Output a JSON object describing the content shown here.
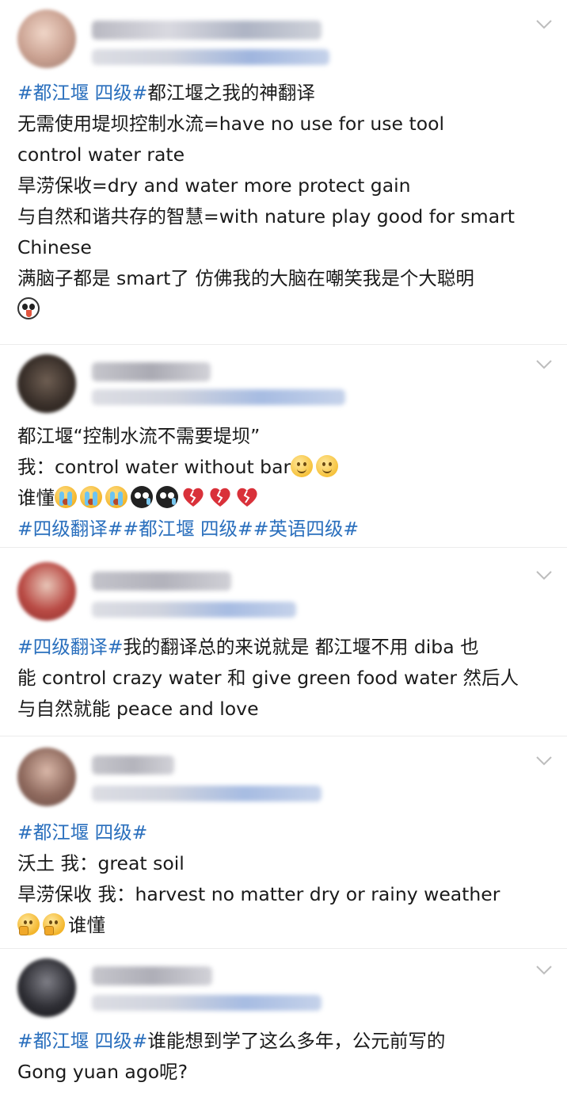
{
  "colors": {
    "hashtag": "#2a6fbd",
    "text": "#1a1a1a",
    "background": "#ffffff"
  },
  "posts": [
    {
      "lines": [
        [
          {
            "t": "tag",
            "v": "#都江堰 四级#"
          },
          {
            "t": "text",
            "v": "都江堰之我的神翻译"
          }
        ],
        [
          {
            "t": "text",
            "v": "无需使用堤坝控制水流=have no use for use tool"
          }
        ],
        [
          {
            "t": "text",
            "v": "control water rate"
          }
        ],
        [
          {
            "t": "text",
            "v": "旱涝保收=dry and water more protect gain"
          }
        ],
        [
          {
            "t": "text",
            "v": "与自然和谐共存的智慧=with nature play good for smart"
          }
        ],
        [
          {
            "t": "text",
            "v": "Chinese"
          }
        ],
        [
          {
            "t": "text",
            "v": "满脑子都是 smart了 仿佛我的大脑在嘲笑我是个大聪明"
          }
        ],
        [
          {
            "t": "emoji",
            "v": "panda-laugh-emoji"
          }
        ]
      ]
    },
    {
      "lines": [
        [
          {
            "t": "text",
            "v": "都江堰“控制水流不需要堤坝”"
          }
        ],
        [
          {
            "t": "text",
            "v": "我：control water without bar"
          },
          {
            "t": "emoji",
            "v": "smile-emoji"
          },
          {
            "t": "emoji",
            "v": "smile-emoji"
          }
        ],
        [
          {
            "t": "text",
            "v": "谁懂"
          },
          {
            "t": "emoji",
            "v": "crying-emoji"
          },
          {
            "t": "emoji",
            "v": "crying-emoji"
          },
          {
            "t": "emoji",
            "v": "crying-emoji"
          },
          {
            "t": "emoji",
            "v": "black-face-emoji"
          },
          {
            "t": "emoji",
            "v": "black-face-emoji"
          },
          {
            "t": "emoji",
            "v": "broken-heart-emoji"
          },
          {
            "t": "emoji",
            "v": "broken-heart-emoji"
          },
          {
            "t": "emoji",
            "v": "broken-heart-emoji"
          }
        ],
        [
          {
            "t": "tag",
            "v": "#四级翻译##都江堰 四级##英语四级#"
          }
        ]
      ]
    },
    {
      "lines": [
        [
          {
            "t": "tag",
            "v": "#四级翻译#"
          },
          {
            "t": "text",
            "v": "我的翻译总的来说就是 都江堰不用 diba 也"
          }
        ],
        [
          {
            "t": "text",
            "v": "能 control crazy water 和 give green food water 然后人"
          }
        ],
        [
          {
            "t": "text",
            "v": "与自然就能 peace and love"
          }
        ]
      ]
    },
    {
      "lines": [
        [
          {
            "t": "tag",
            "v": "#都江堰 四级#"
          }
        ],
        [
          {
            "t": "text",
            "v": "沃土 我：great soil"
          }
        ],
        [
          {
            "t": "text",
            "v": "旱涝保收 我：harvest no matter dry or rainy weather"
          }
        ],
        [
          {
            "t": "emoji",
            "v": "thinking-emoji"
          },
          {
            "t": "emoji",
            "v": "thinking-emoji"
          },
          {
            "t": "text",
            "v": "谁懂"
          }
        ]
      ]
    },
    {
      "lines": [
        [
          {
            "t": "tag",
            "v": "#都江堰 四级#"
          },
          {
            "t": "text",
            "v": "谁能想到学了这么多年，公元前写的"
          }
        ],
        [
          {
            "t": "text",
            "v": "Gong yuan ago呢?"
          }
        ]
      ]
    }
  ]
}
